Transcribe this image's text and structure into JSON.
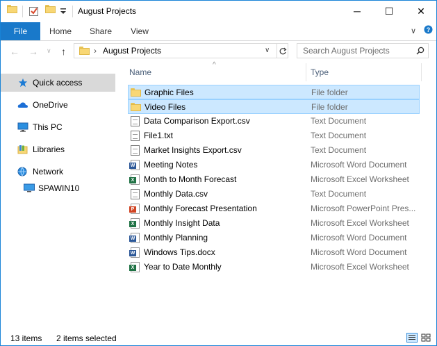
{
  "window": {
    "title": "August Projects",
    "controls": {
      "minimize": "─",
      "maximize": "☐",
      "close": "✕"
    }
  },
  "ribbon": {
    "tabs": [
      "File",
      "Home",
      "Share",
      "View"
    ],
    "collapse_glyph": "∨",
    "help_glyph": "?"
  },
  "nav": {
    "back": "←",
    "forward": "→",
    "recent": "∨",
    "up": "↑",
    "breadcrumb_sep": "›",
    "location": "August Projects",
    "search_placeholder": "Search August Projects"
  },
  "sidebar": {
    "items": [
      {
        "label": "Quick access",
        "icon": "star-icon",
        "selected": true
      },
      {
        "label": "OneDrive",
        "icon": "cloud-icon"
      },
      {
        "label": "This PC",
        "icon": "computer-icon"
      },
      {
        "label": "Libraries",
        "icon": "libraries-icon"
      },
      {
        "label": "Network",
        "icon": "network-icon"
      },
      {
        "label": "SPAWIN10",
        "icon": "monitor-icon"
      }
    ]
  },
  "list": {
    "columns": {
      "name": "Name",
      "type": "Type"
    },
    "sort_glyph": "^",
    "rows": [
      {
        "name": "Graphic Files",
        "type": "File folder",
        "icon": "folder",
        "selected": true
      },
      {
        "name": "Video Files",
        "type": "File folder",
        "icon": "folder",
        "selected": true
      },
      {
        "name": "Data Comparison Export.csv",
        "type": "Text Document",
        "icon": "text"
      },
      {
        "name": "File1.txt",
        "type": "Text Document",
        "icon": "text"
      },
      {
        "name": "Market Insights Export.csv",
        "type": "Text Document",
        "icon": "text"
      },
      {
        "name": "Meeting Notes",
        "type": "Microsoft Word Document",
        "icon": "word"
      },
      {
        "name": "Month to Month Forecast",
        "type": "Microsoft Excel Worksheet",
        "icon": "excel"
      },
      {
        "name": "Monthly Data.csv",
        "type": "Text Document",
        "icon": "text"
      },
      {
        "name": "Monthly Forecast Presentation",
        "type": "Microsoft PowerPoint Pres...",
        "icon": "ppt"
      },
      {
        "name": "Monthly Insight Data",
        "type": "Microsoft Excel Worksheet",
        "icon": "excel"
      },
      {
        "name": "Monthly Planning",
        "type": "Microsoft Word Document",
        "icon": "word"
      },
      {
        "name": "Windows Tips.docx",
        "type": "Microsoft Word Document",
        "icon": "word"
      },
      {
        "name": "Year to Date Monthly",
        "type": "Microsoft Excel Worksheet",
        "icon": "excel"
      }
    ]
  },
  "status": {
    "item_count": "13 items",
    "selection": "2 items selected"
  },
  "colors": {
    "accent": "#1979ca",
    "selection": "#cce8ff",
    "folder": "#f8d775"
  }
}
